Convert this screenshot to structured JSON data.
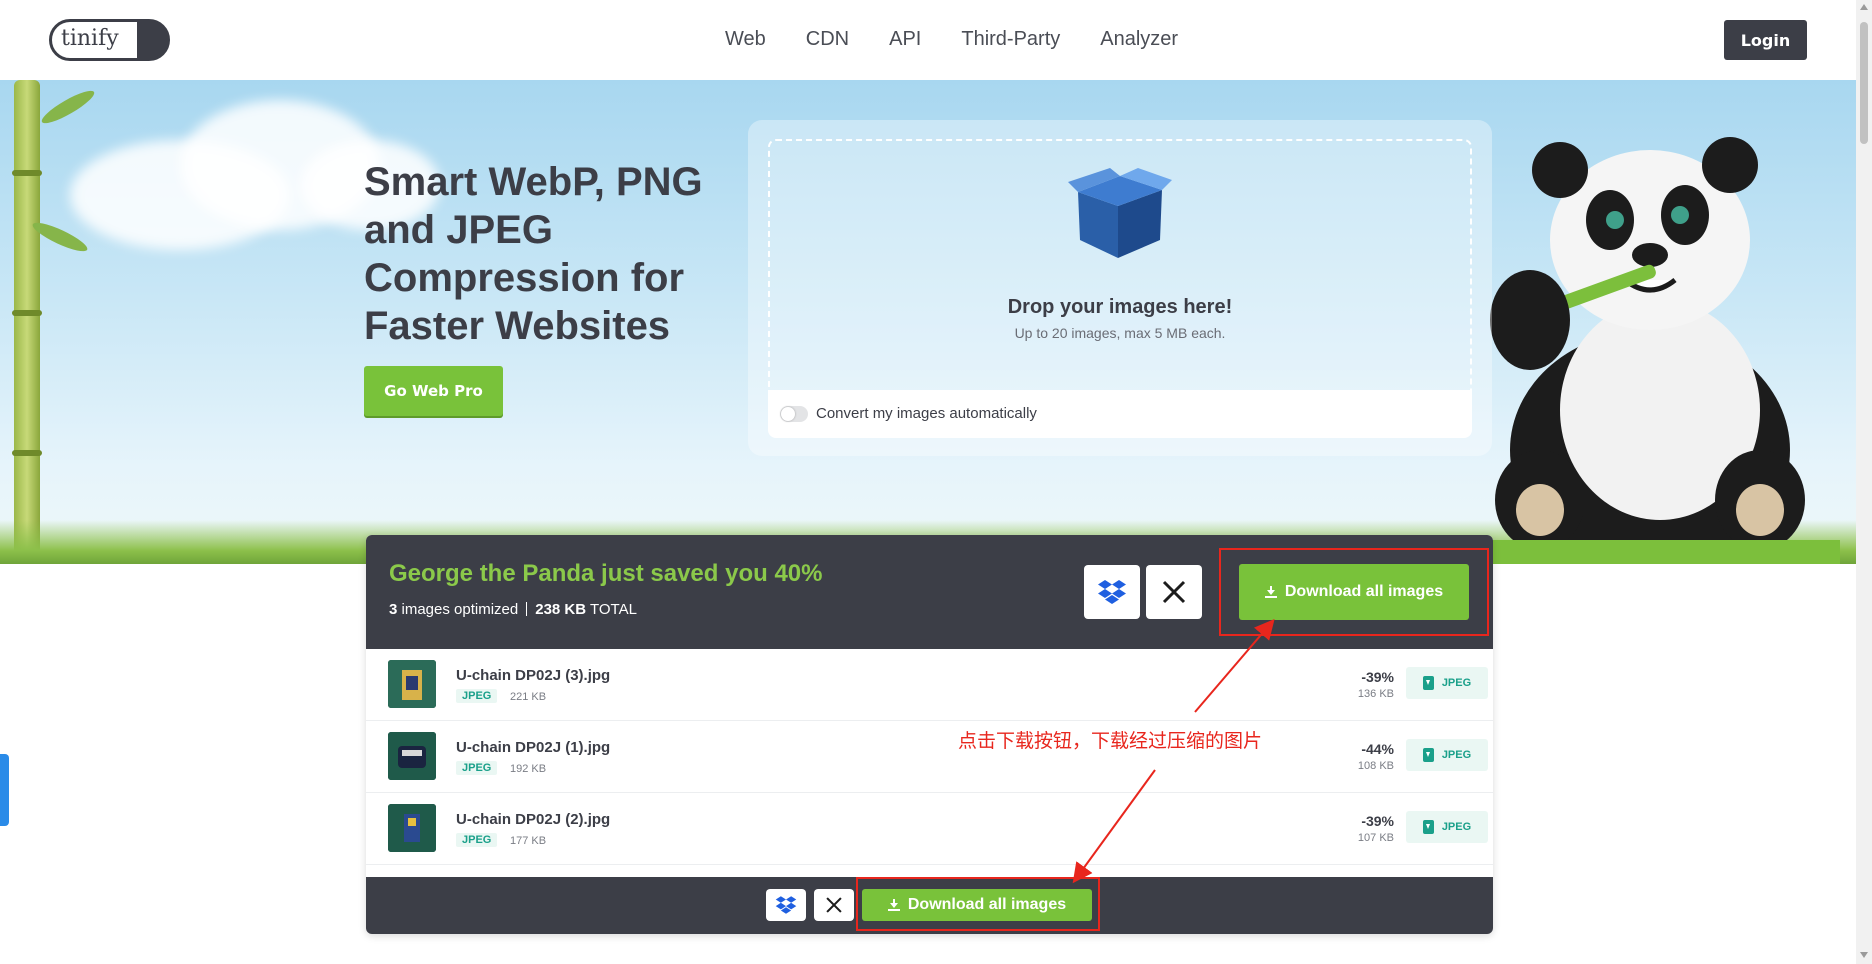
{
  "header": {
    "logo_text": "tinify",
    "nav": [
      "Web",
      "CDN",
      "API",
      "Third-Party",
      "Analyzer"
    ],
    "login_label": "Login"
  },
  "hero": {
    "headline": "Smart WebP, PNG and JPEG Compression for Faster Websites",
    "cta_label": "Go Web Pro",
    "drop_title": "Drop your images here!",
    "drop_subtitle": "Up to 20 images, max 5 MB each.",
    "convert_label": "Convert my images automatically",
    "convert_enabled": false
  },
  "results": {
    "saved_title": "George the Panda just saved you 40%",
    "images_count": "3",
    "images_label": "images optimized",
    "total_size": "238 KB",
    "total_label": "TOTAL",
    "download_all_label": "Download all images",
    "files": [
      {
        "name": "U-chain DP02J (3).jpg",
        "type": "JPEG",
        "original_size": "221 KB",
        "saving": "-39%",
        "new_size": "136 KB",
        "format_label": "JPEG"
      },
      {
        "name": "U-chain DP02J (1).jpg",
        "type": "JPEG",
        "original_size": "192 KB",
        "saving": "-44%",
        "new_size": "108 KB",
        "format_label": "JPEG"
      },
      {
        "name": "U-chain DP02J (2).jpg",
        "type": "JPEG",
        "original_size": "177 KB",
        "saving": "-39%",
        "new_size": "107 KB",
        "format_label": "JPEG"
      }
    ],
    "footer_download_label": "Download all images"
  },
  "annotation": {
    "text": "点击下载按钮，下载经过压缩的图片",
    "color": "#e8261d"
  },
  "colors": {
    "accent_green": "#79c23a",
    "dark": "#3c3e47",
    "teal": "#1aa08a"
  }
}
